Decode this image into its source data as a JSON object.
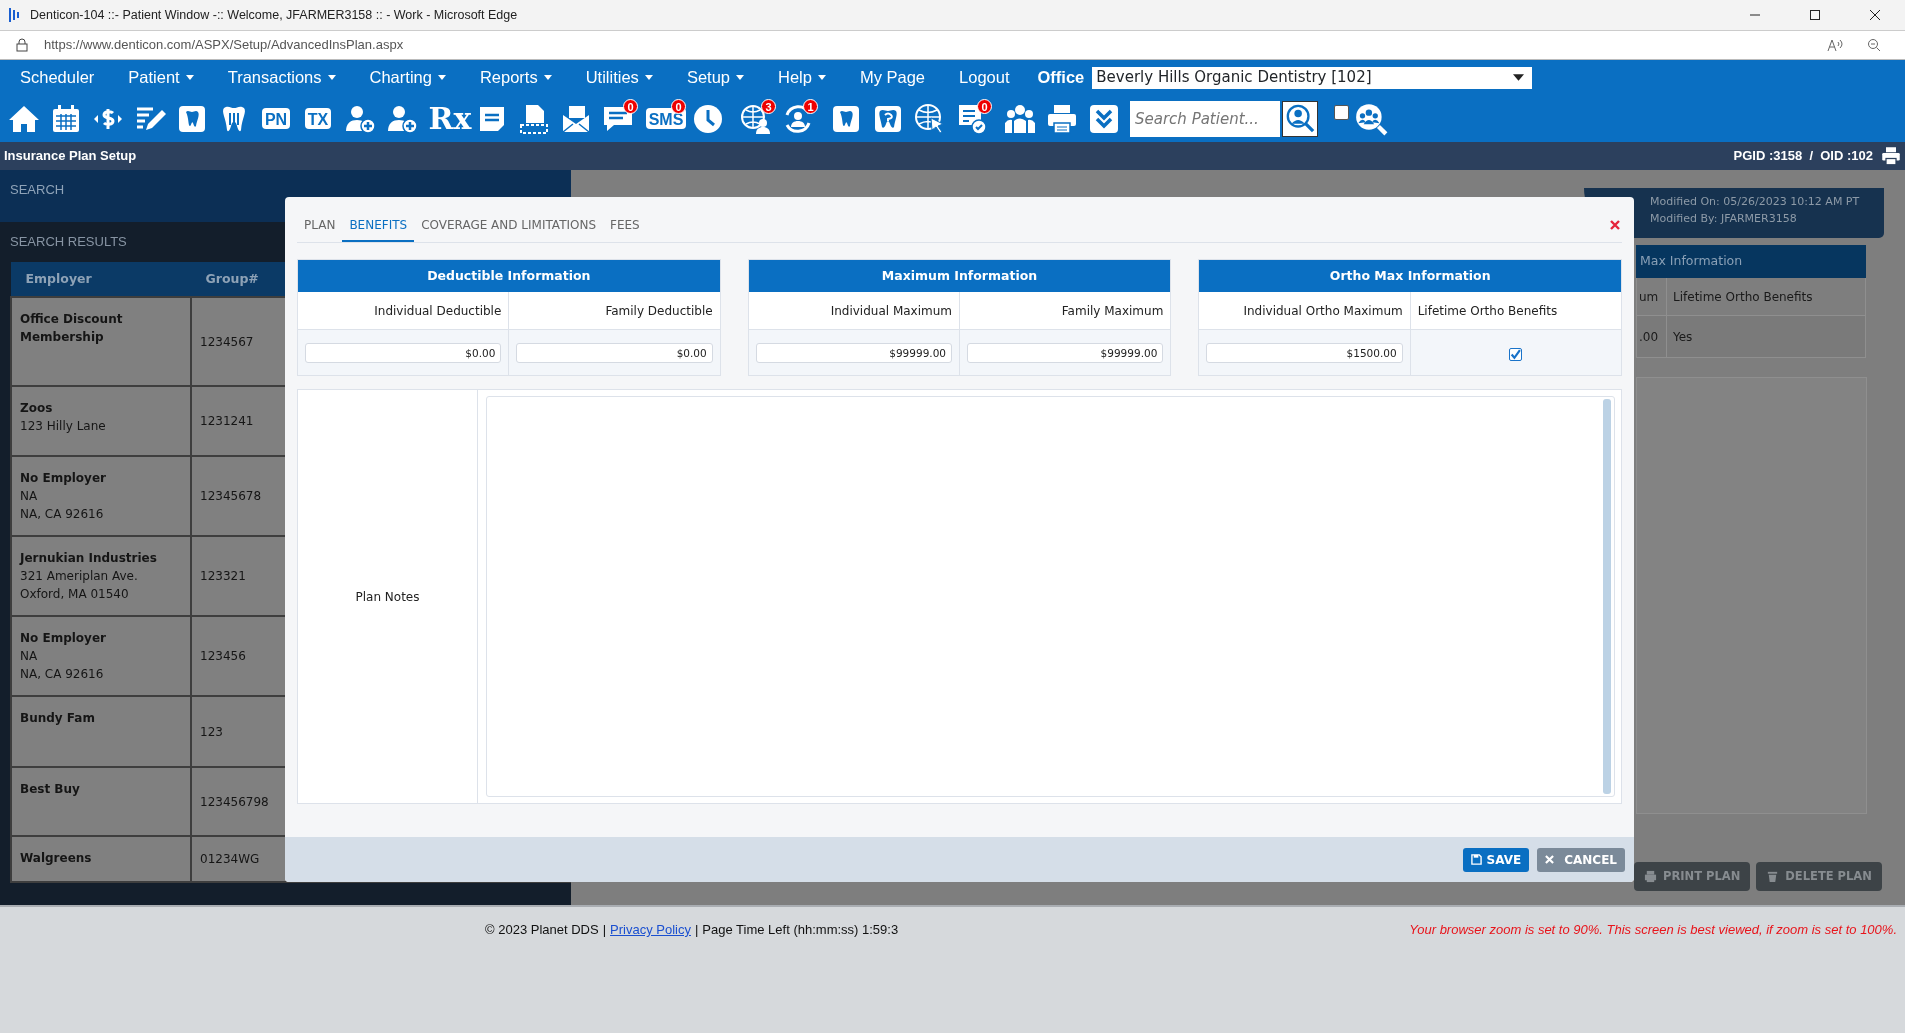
{
  "window": {
    "title": "Denticon-104 ::- Patient Window -:: Welcome, JFARMER3158 :: - Work - Microsoft Edge"
  },
  "address_bar": {
    "url": "https://www.denticon.com/ASPX/Setup/AdvancedInsPlan.aspx"
  },
  "menu": [
    {
      "label": "Scheduler",
      "dropdown": false
    },
    {
      "label": "Patient",
      "dropdown": true
    },
    {
      "label": "Transactions",
      "dropdown": true
    },
    {
      "label": "Charting",
      "dropdown": true
    },
    {
      "label": "Reports",
      "dropdown": true
    },
    {
      "label": "Utilities",
      "dropdown": true
    },
    {
      "label": "Setup",
      "dropdown": true
    },
    {
      "label": "Help",
      "dropdown": true
    },
    {
      "label": "My Page",
      "dropdown": false
    },
    {
      "label": "Logout",
      "dropdown": false
    }
  ],
  "office": {
    "label": "Office",
    "value": "Beverly Hills Organic Dentistry [102]"
  },
  "toolbar": {
    "labels": [
      "PN",
      "TX",
      "Rx",
      "SMS"
    ],
    "badges": [
      "0",
      "0",
      "3",
      "1",
      "0"
    ],
    "search": {
      "placeholder": "Search Patient..."
    },
    "checkbox": {
      "checked": false
    }
  },
  "page_header": {
    "title": "Insurance Plan Setup",
    "ids": "PGID :3158  /  OID :102"
  },
  "search_panel": {
    "title": "SEARCH",
    "results_title": "SEARCH RESULTS",
    "columns": [
      "Employer",
      "Group#"
    ],
    "rows": [
      {
        "employer": "Office Discount Membership",
        "address": [],
        "group": "1234567"
      },
      {
        "employer": "Zoos",
        "address": [
          "123 Hilly Lane"
        ],
        "group": "1231241"
      },
      {
        "employer": "No Employer",
        "address": [
          "NA",
          "NA, CA 92616"
        ],
        "group": "12345678"
      },
      {
        "employer": "Jernukian Industries",
        "address": [
          "321 Ameriplan Ave.",
          "Oxford, MA 01540"
        ],
        "group": "123321"
      },
      {
        "employer": "No Employer",
        "address": [
          "NA",
          "NA, CA 92616"
        ],
        "group": "123456"
      },
      {
        "employer": "Bundy Fam",
        "address": [],
        "group": "123"
      },
      {
        "employer": "Best Buy",
        "address": [],
        "group": "123456798"
      },
      {
        "employer": "Walgreens",
        "address": [],
        "group": "01234WG"
      }
    ]
  },
  "plan_summary": {
    "modified_on": "Modified On: 05/26/2023 10:12 AM PT",
    "modified_by": "Modified By: JFARMER3158",
    "section_title": "Max Information",
    "header_cells": [
      "um",
      "Lifetime Ortho Benefits"
    ],
    "value_cells": [
      ".00",
      "Yes"
    ],
    "buttons": [
      "PRINT PLAN",
      "DELETE PLAN"
    ]
  },
  "modal": {
    "tabs": [
      {
        "label": "PLAN",
        "selected": false
      },
      {
        "label": "BENEFITS",
        "selected": true
      },
      {
        "label": "COVERAGE AND LIMITATIONS",
        "selected": false
      },
      {
        "label": "FEES",
        "selected": false
      }
    ],
    "sections": [
      {
        "title": "Deductible Information",
        "fields": [
          {
            "label": "Individual Deductible",
            "kind": "amount",
            "value": "$0.00"
          },
          {
            "label": "Family Deductible",
            "kind": "amount",
            "value": "$0.00"
          }
        ]
      },
      {
        "title": "Maximum Information",
        "fields": [
          {
            "label": "Individual Maximum",
            "kind": "amount",
            "value": "$99999.00"
          },
          {
            "label": "Family Maximum",
            "kind": "amount",
            "value": "$99999.00"
          }
        ]
      },
      {
        "title": "Ortho Max Information",
        "fields": [
          {
            "label": "Individual Ortho Maximum",
            "kind": "amount",
            "value": "$1500.00"
          },
          {
            "label": "Lifetime Ortho Benefits",
            "kind": "checkbox",
            "checked": true
          }
        ]
      }
    ],
    "notes": {
      "label": "Plan Notes"
    },
    "buttons": [
      {
        "label": "SAVE",
        "kind": "primary"
      },
      {
        "label": "CANCEL",
        "kind": "secondary"
      }
    ]
  },
  "footer": {
    "copyright": "© 2023 Planet DDS",
    "separators": [
      "|",
      "|"
    ],
    "link": "Privacy Policy",
    "time_left": "Page Time Left (hh:mm:ss) 1:59:3",
    "warning": "Your browser zoom is set to 90%. This screen is best viewed, if zoom is set to 100%."
  }
}
